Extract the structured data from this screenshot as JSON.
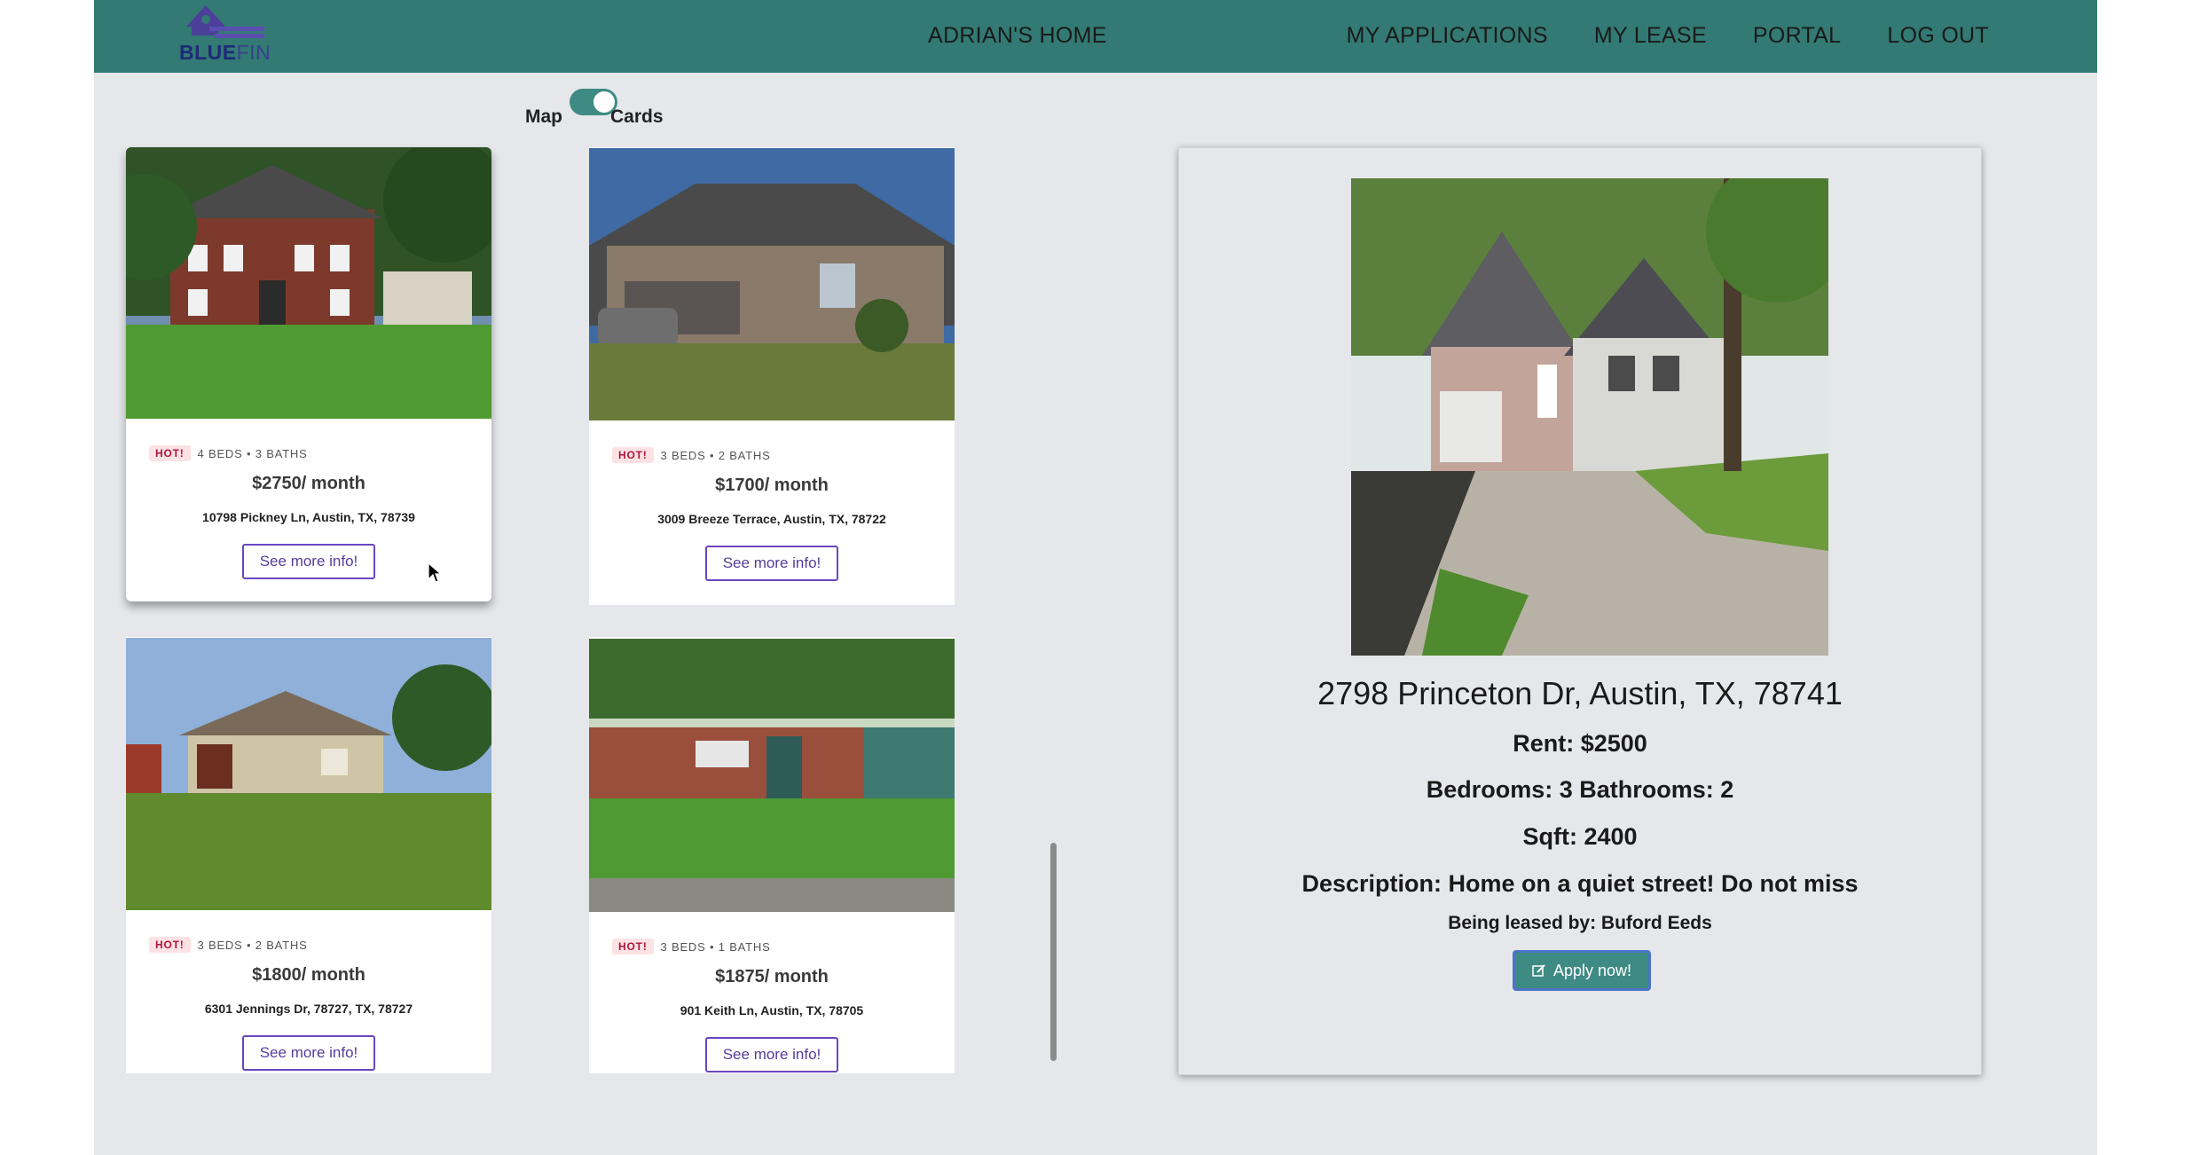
{
  "header": {
    "logo_text_bold": "BLUE",
    "logo_text_light": "FIN",
    "title": "ADRIAN'S HOME",
    "nav": [
      "MY APPLICATIONS",
      "MY LEASE",
      "PORTAL",
      "LOG OUT"
    ]
  },
  "view_toggle": {
    "left_label": "Map",
    "right_label": "Cards",
    "selected": "Cards"
  },
  "listings": [
    {
      "badge": "HOT!",
      "meta": "4 BEDS • 3 BATHS",
      "price": "$2750/ month",
      "address": "10798 Pickney Ln, Austin, TX, 78739",
      "button": "See more info!"
    },
    {
      "badge": "HOT!",
      "meta": "3 BEDS • 2 BATHS",
      "price": "$1700/ month",
      "address": "3009 Breeze Terrace, Austin, TX, 78722",
      "button": "See more info!"
    },
    {
      "badge": "HOT!",
      "meta": "3 BEDS • 2 BATHS",
      "price": "$1800/ month",
      "address": "6301 Jennings Dr, 78727, TX, 78727",
      "button": "See more info!"
    },
    {
      "badge": "HOT!",
      "meta": "3 BEDS • 1 BATHS",
      "price": "$1875/ month",
      "address": "901 Keith Ln, Austin, TX, 78705",
      "button": "See more info!"
    }
  ],
  "detail": {
    "address": "2798 Princeton Dr, Austin, TX, 78741",
    "rent": "Rent: $2500",
    "rooms": "Bedrooms: 3 Bathrooms: 2",
    "sqft": "Sqft: 2400",
    "description": "Description: Home on a quiet street! Do not miss",
    "leased_by": "Being leased by: Buford Eeds",
    "apply_label": "Apply now!"
  },
  "colors": {
    "navbar": "#327a73",
    "accent_button": "#3e8b83",
    "badge_bg": "#fde2e4",
    "badge_text": "#b0143c",
    "outline_button": "#6b46c1"
  }
}
